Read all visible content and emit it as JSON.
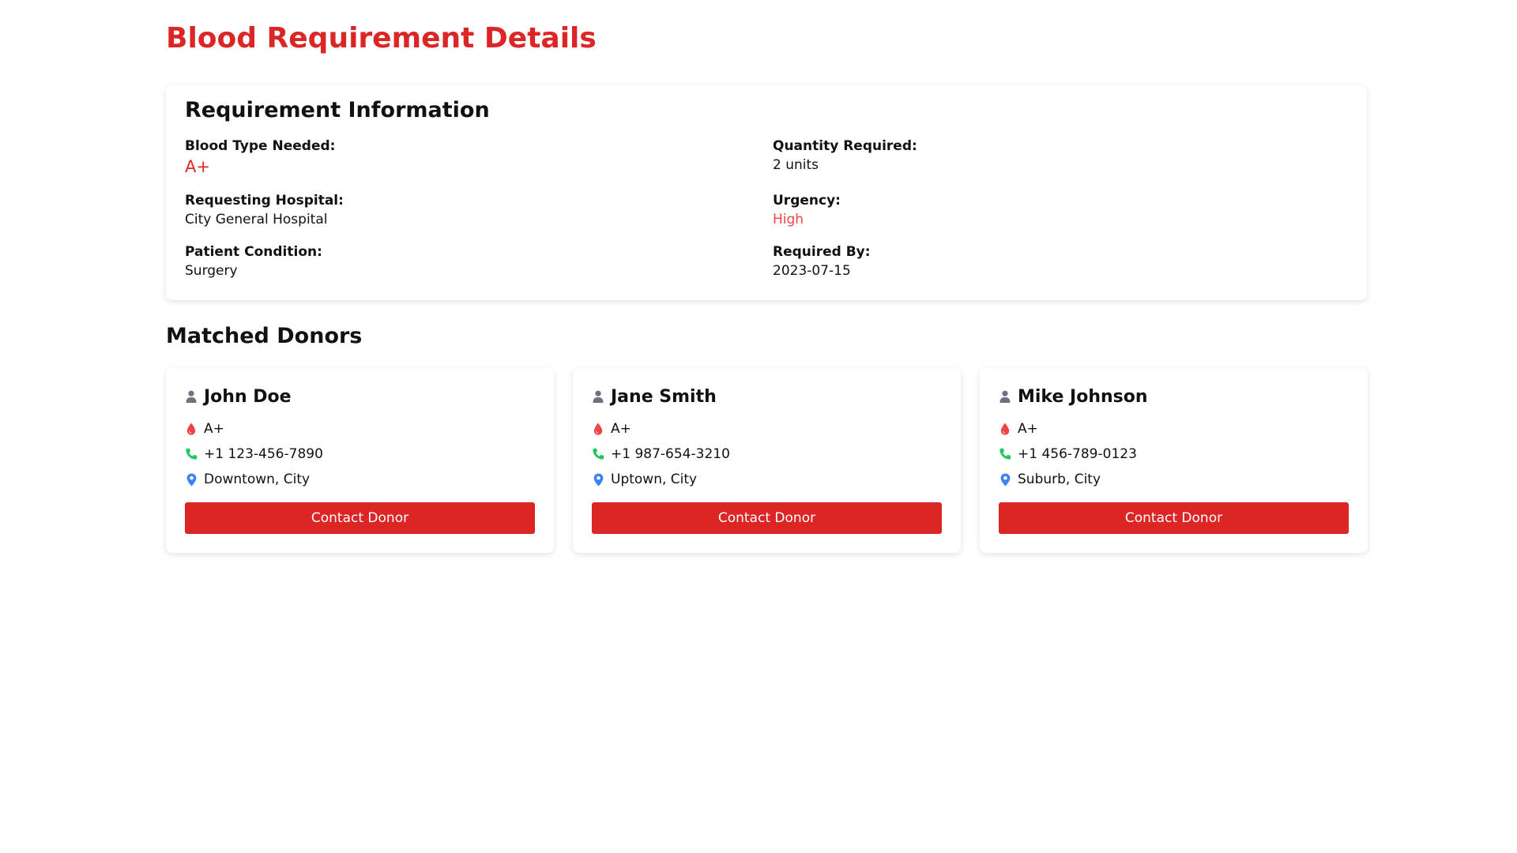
{
  "page": {
    "title": "Blood Requirement Details"
  },
  "requirement": {
    "heading": "Requirement Information",
    "blood_type_label": "Blood Type Needed:",
    "blood_type_value": "A+",
    "quantity_label": "Quantity Required:",
    "quantity_value": "2 units",
    "hospital_label": "Requesting Hospital:",
    "hospital_value": "City General Hospital",
    "urgency_label": "Urgency:",
    "urgency_value": "High",
    "condition_label": "Patient Condition:",
    "condition_value": "Surgery",
    "required_by_label": "Required By:",
    "required_by_value": "2023-07-15"
  },
  "donors_section": {
    "title": "Matched Donors",
    "donors": [
      {
        "name": "John Doe",
        "blood_type": "A+",
        "phone": "+1 123-456-7890",
        "location": "Downtown, City",
        "button_label": "Contact Donor"
      },
      {
        "name": "Jane Smith",
        "blood_type": "A+",
        "phone": "+1 987-654-3210",
        "location": "Uptown, City",
        "button_label": "Contact Donor"
      },
      {
        "name": "Mike Johnson",
        "blood_type": "A+",
        "phone": "+1 456-789-0123",
        "location": "Suburb, City",
        "button_label": "Contact Donor"
      }
    ]
  },
  "icons": {
    "user": "user-icon",
    "blood": "blood-drop-icon",
    "phone": "phone-icon",
    "location": "map-pin-icon"
  },
  "colors": {
    "accent": "#dc2626",
    "urgency_high": "#ef4444",
    "user_icon": "#6b7280",
    "blood_icon": "#ef4444",
    "phone_icon": "#22c55e",
    "location_icon": "#3b82f6"
  }
}
